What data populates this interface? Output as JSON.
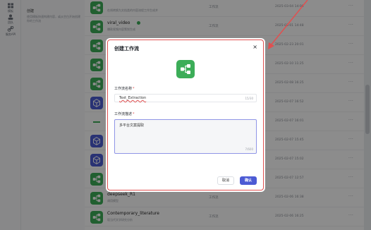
{
  "nav": {
    "items": [
      {
        "label": "模板"
      },
      {
        "label": "团队"
      },
      {
        "label": "服务API"
      }
    ]
  },
  "guide": {
    "title": "创建",
    "desc": "使用模板快速构建内容，或从空白开始创建你的工作流"
  },
  "rows": [
    {
      "name": "",
      "desc": "在线转换为文档类的内容流程工作生成并",
      "type": "工作流",
      "date": "2025-03-04 14:00",
      "variant": "green"
    },
    {
      "name": "viral_video",
      "desc": "爆款视频内容策划生成",
      "type": "工作流",
      "date": "2025-03-01 14:48",
      "variant": "green",
      "ok": true
    },
    {
      "name": "",
      "desc": "",
      "type": "",
      "date": "2025-02-23 20:01",
      "variant": "green"
    },
    {
      "name": "",
      "desc": "",
      "type": "",
      "date": "2025-02-10 11:25",
      "variant": "green"
    },
    {
      "name": "",
      "desc": "",
      "type": "",
      "date": "2025-02-08 16:25",
      "variant": "green"
    },
    {
      "name": "",
      "desc": "",
      "type": "",
      "date": "2025-02-07 16:52",
      "variant": "blue"
    },
    {
      "name": "",
      "desc": "",
      "type": "",
      "date": "2025-02-07 16:01",
      "variant": "dash"
    },
    {
      "name": "",
      "desc": "",
      "type": "",
      "date": "2025-02-07 15:45",
      "variant": "blue"
    },
    {
      "name": "",
      "desc": "",
      "type": "",
      "date": "2025-02-07 15:02",
      "variant": "blue"
    },
    {
      "name": "",
      "desc": "",
      "type": "",
      "date": "2025-02-07 12:57",
      "variant": "green"
    },
    {
      "name": "deepseek_R1",
      "desc": "调用模型",
      "type": "工作流",
      "date": "2025-02-06 16:38",
      "variant": "green"
    },
    {
      "name": "Contemporary_literature",
      "desc": "现当代文学研究分析",
      "type": "工作流",
      "date": "2025-02-06 16:25",
      "variant": "green"
    }
  ],
  "modal": {
    "title": "创建工作流",
    "close": "×",
    "name_label": "工作流名称",
    "required_mark": "*",
    "name_value": "Text_Extraction",
    "name_count": "15/30",
    "desc_label": "工作流描述",
    "desc_value": "多平台文案提取",
    "desc_count": "7/600",
    "cancel": "取消",
    "confirm": "确认"
  },
  "colors": {
    "accent": "#4c5bd4",
    "green": "#3cad58",
    "highlight": "#e05050"
  }
}
